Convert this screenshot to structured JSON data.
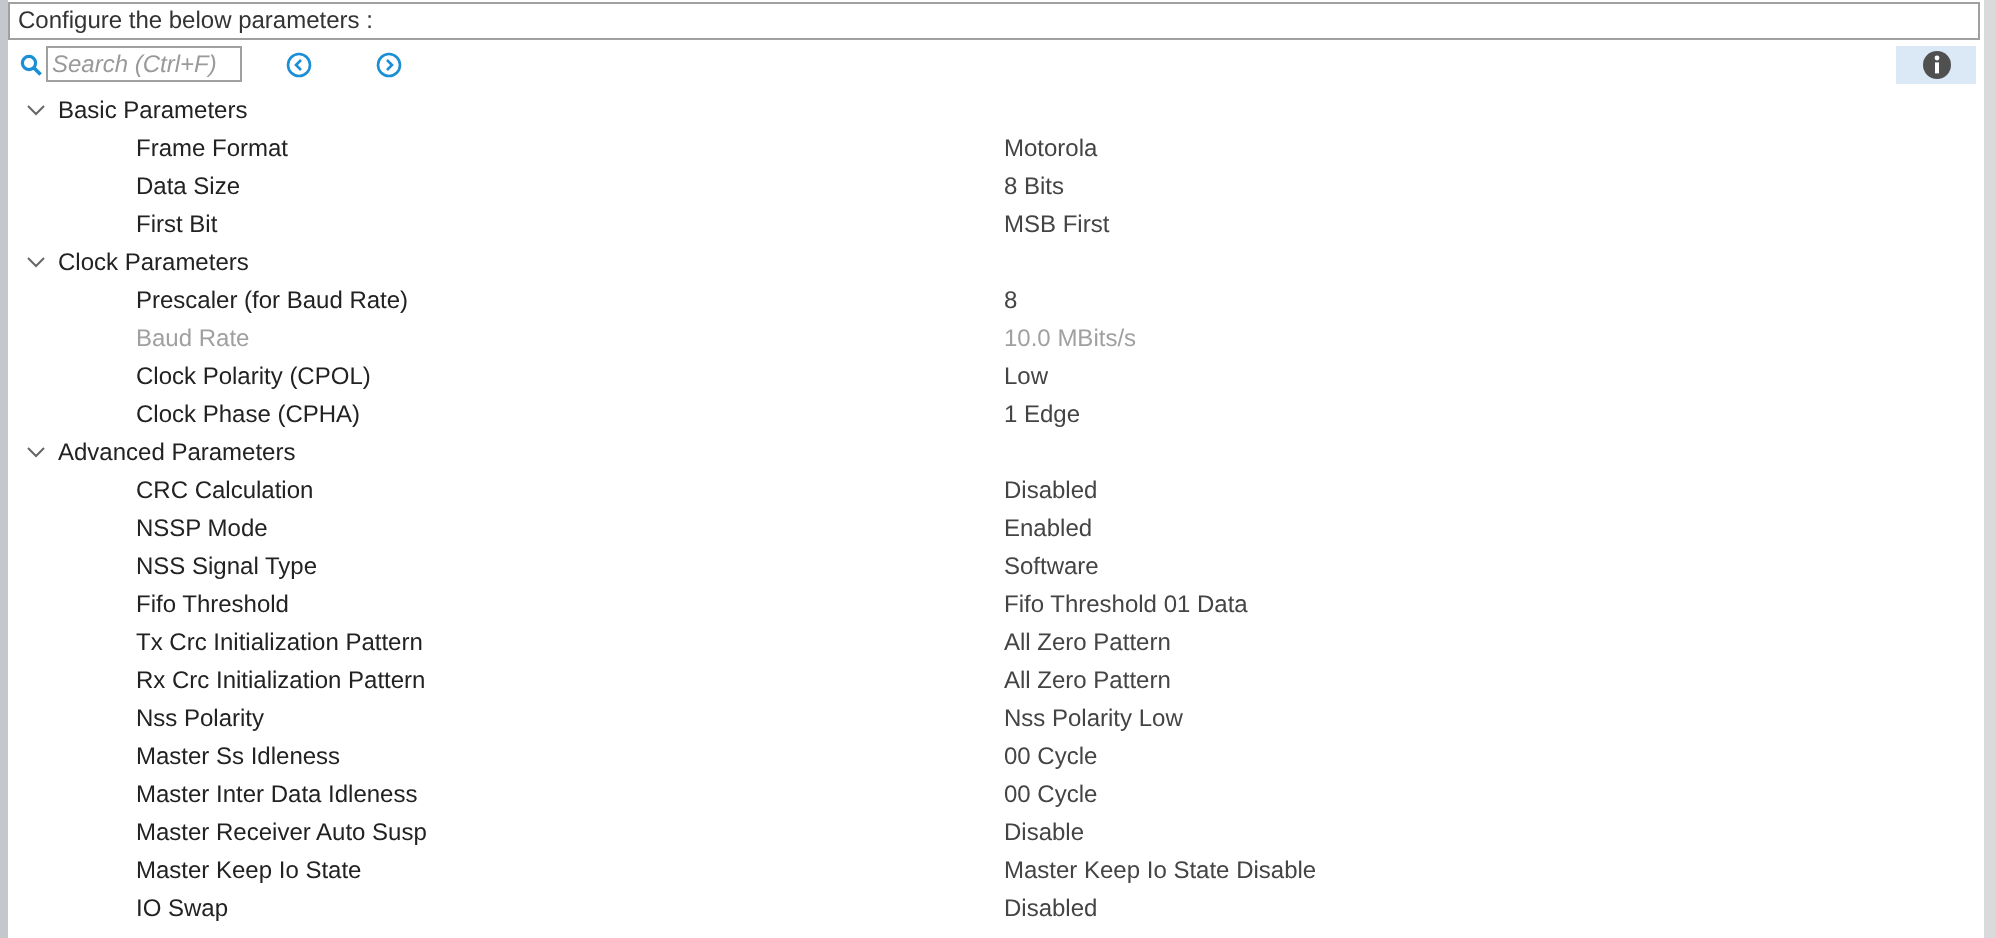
{
  "header": "Configure the below parameters :",
  "search": {
    "placeholder": "Search (Ctrl+F)"
  },
  "groups": [
    {
      "label": "Basic Parameters",
      "expanded": true,
      "children": [
        {
          "name": "Frame Format",
          "value": "Motorola",
          "disabled": false
        },
        {
          "name": "Data Size",
          "value": "8 Bits",
          "disabled": false
        },
        {
          "name": "First Bit",
          "value": "MSB First",
          "disabled": false
        }
      ]
    },
    {
      "label": "Clock Parameters",
      "expanded": true,
      "children": [
        {
          "name": "Prescaler (for Baud Rate)",
          "value": "8",
          "disabled": false
        },
        {
          "name": "Baud Rate",
          "value": "10.0 MBits/s",
          "disabled": true
        },
        {
          "name": "Clock Polarity (CPOL)",
          "value": "Low",
          "disabled": false
        },
        {
          "name": "Clock Phase (CPHA)",
          "value": "1 Edge",
          "disabled": false
        }
      ]
    },
    {
      "label": "Advanced Parameters",
      "expanded": true,
      "children": [
        {
          "name": "CRC Calculation",
          "value": "Disabled",
          "disabled": false
        },
        {
          "name": "NSSP Mode",
          "value": "Enabled",
          "disabled": false
        },
        {
          "name": "NSS Signal Type",
          "value": "Software",
          "disabled": false
        },
        {
          "name": "Fifo Threshold",
          "value": "Fifo Threshold 01 Data",
          "disabled": false
        },
        {
          "name": "Tx Crc Initialization Pattern",
          "value": "All Zero Pattern",
          "disabled": false
        },
        {
          "name": "Rx Crc Initialization Pattern",
          "value": "All Zero Pattern",
          "disabled": false
        },
        {
          "name": "Nss Polarity",
          "value": "Nss Polarity Low",
          "disabled": false
        },
        {
          "name": "Master Ss Idleness",
          "value": "00 Cycle",
          "disabled": false
        },
        {
          "name": "Master Inter Data Idleness",
          "value": "00 Cycle",
          "disabled": false
        },
        {
          "name": "Master Receiver Auto Susp",
          "value": "Disable",
          "disabled": false
        },
        {
          "name": "Master Keep Io State",
          "value": "Master Keep Io State Disable",
          "disabled": false
        },
        {
          "name": "IO Swap",
          "value": "Disabled",
          "disabled": false
        }
      ]
    }
  ]
}
